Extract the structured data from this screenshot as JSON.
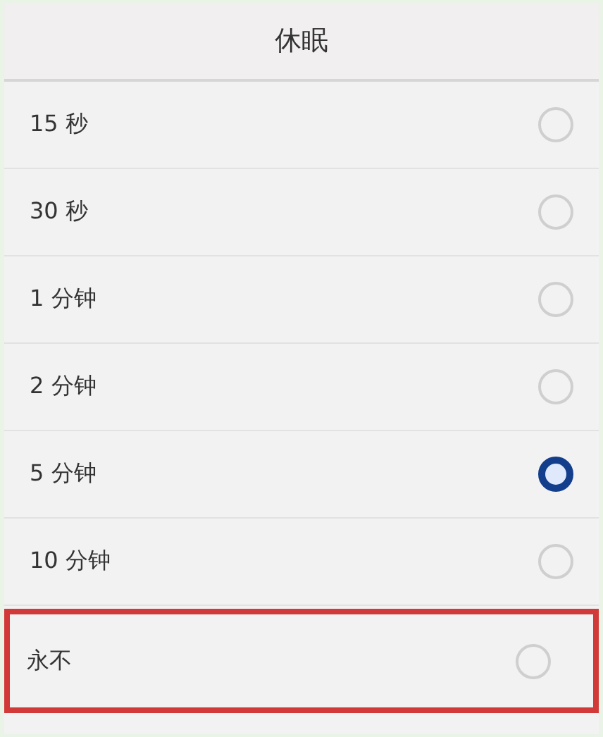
{
  "dialog": {
    "title": "休眠"
  },
  "options": [
    {
      "label": "15 秒",
      "selected": false,
      "highlighted": false
    },
    {
      "label": "30 秒",
      "selected": false,
      "highlighted": false
    },
    {
      "label": "1 分钟",
      "selected": false,
      "highlighted": false
    },
    {
      "label": "2 分钟",
      "selected": false,
      "highlighted": false
    },
    {
      "label": "5 分钟",
      "selected": true,
      "highlighted": false
    },
    {
      "label": "10 分钟",
      "selected": false,
      "highlighted": false
    },
    {
      "label": "永不",
      "selected": false,
      "highlighted": true
    }
  ]
}
